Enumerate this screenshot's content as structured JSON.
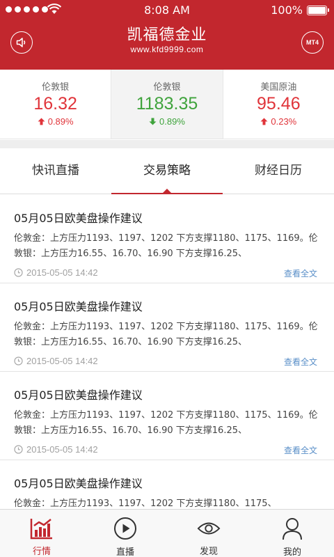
{
  "status_bar": {
    "time": "8:08 AM",
    "battery": "100%"
  },
  "header": {
    "title": "凯福德金业",
    "url": "www.kfd9999.com",
    "right_badge": "MT4",
    "accent_color": "#c2272e"
  },
  "quotes": [
    {
      "name": "伦敦银",
      "price": "16.32",
      "change": "0.89%",
      "direction": "up"
    },
    {
      "name": "伦敦银",
      "price": "1183.35",
      "change": "0.89%",
      "direction": "down"
    },
    {
      "name": "美国原油",
      "price": "95.46",
      "change": "0.23%",
      "direction": "up"
    }
  ],
  "tabs": [
    {
      "label": "快讯直播",
      "active": false
    },
    {
      "label": "交易策略",
      "active": true
    },
    {
      "label": "财经日历",
      "active": false
    }
  ],
  "articles": [
    {
      "title": "05月05日欧美盘操作建议",
      "body": "伦敦金：上方压力1193、1197、1202 下方支撑1180、1175、1169。伦敦银：上方压力16.55、16.70、16.90 下方支撑16.25、",
      "time": "2015-05-05 14:42",
      "more": "查看全文"
    },
    {
      "title": "05月05日欧美盘操作建议",
      "body": "伦敦金：上方压力1193、1197、1202 下方支撑1180、1175、1169。伦敦银：上方压力16.55、16.70、16.90 下方支撑16.25、",
      "time": "2015-05-05 14:42",
      "more": "查看全文"
    },
    {
      "title": "05月05日欧美盘操作建议",
      "body": "伦敦金：上方压力1193、1197、1202 下方支撑1180、1175、1169。伦敦银：上方压力16.55、16.70、16.90 下方支撑16.25、",
      "time": "2015-05-05 14:42",
      "more": "查看全文"
    },
    {
      "title": "05月05日欧美盘操作建议",
      "body": "伦敦金：上方压力1193、1197、1202 下方支撑1180、1175、",
      "time": "",
      "more": ""
    }
  ],
  "bottom_nav": [
    {
      "label": "行情",
      "icon": "market-chart-icon",
      "active": true
    },
    {
      "label": "直播",
      "icon": "play-icon",
      "active": false
    },
    {
      "label": "发现",
      "icon": "eye-icon",
      "active": false
    },
    {
      "label": "我的",
      "icon": "user-icon",
      "active": false
    }
  ]
}
